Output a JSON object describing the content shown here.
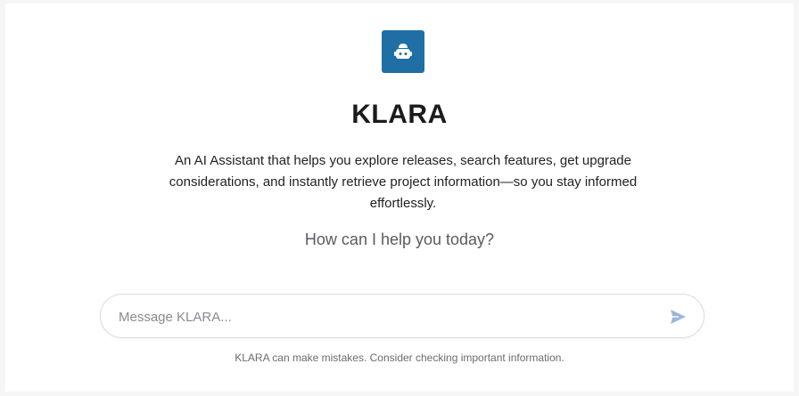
{
  "app": {
    "logo_icon": "robot-icon",
    "title": "KLARA",
    "description": "An AI Assistant that helps you explore releases, search features, get upgrade considerations, and instantly retrieve project information—so you stay informed effortlessly.",
    "help_prompt": "How can I help you today?"
  },
  "composer": {
    "placeholder": "Message KLARA...",
    "value": "",
    "send_icon": "send-icon"
  },
  "footer": {
    "disclaimer": "KLARA can make mistakes. Consider checking important information."
  },
  "colors": {
    "accent": "#1f6fa5",
    "send_icon": "#9bb6d9"
  }
}
